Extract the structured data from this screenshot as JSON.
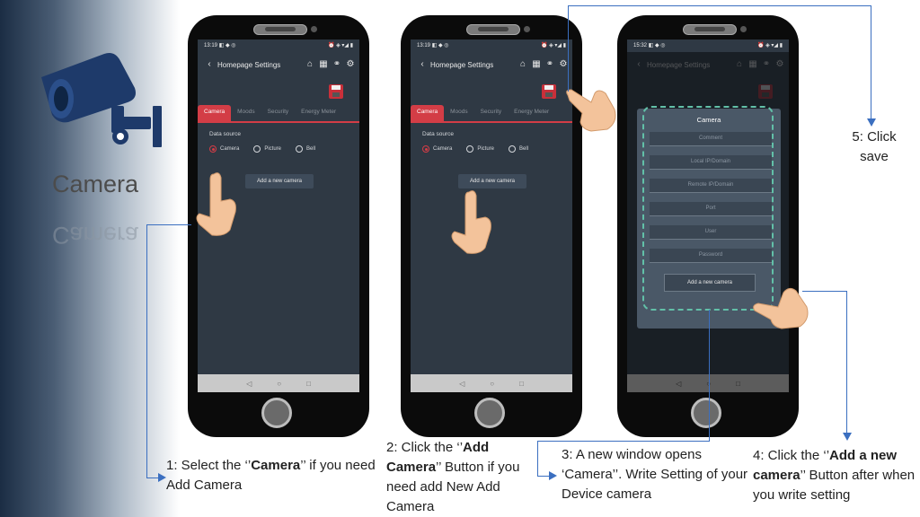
{
  "left_panel": {
    "title": "Camera"
  },
  "phones": [
    {
      "status_time": "13:19",
      "status_icons": "◧ ◆ ◎",
      "status_right": "⏰ ◈ ▾◢ ▮",
      "nav_title": "Homepage Settings",
      "tabs": [
        "Camera",
        "Moods",
        "Security",
        "Energy Meter"
      ],
      "data_source_label": "Data source",
      "radios": [
        "Camera",
        "Picture",
        "Bell"
      ],
      "add_button": "Add a new camera"
    },
    {
      "status_time": "13:19",
      "status_icons": "◧ ◆ ◎",
      "status_right": "⏰ ◈ ▾◢ ▮",
      "nav_title": "Homepage Settings",
      "tabs": [
        "Camera",
        "Moods",
        "Security",
        "Energy Meter"
      ],
      "data_source_label": "Data source",
      "radios": [
        "Camera",
        "Picture",
        "Bell"
      ],
      "add_button": "Add a new camera"
    },
    {
      "status_time": "15:32",
      "status_icons": "◧ ◆ ◎",
      "status_right": "⏰ ◈ ▾◢ ▮",
      "nav_title": "Homepage Settings",
      "dialog_title": "Camera",
      "fields": [
        "Comment",
        "Local IP/Domain",
        "Remote IP/Domain",
        "Port",
        "User",
        "Password"
      ],
      "dialog_button": "Add a new camera"
    }
  ],
  "captions": {
    "step1": {
      "pre": "1: Select the ‘’",
      "bold": "Camera",
      "post": "’’ if you need Add Camera"
    },
    "step2": {
      "pre": "2: Click the ‘’",
      "bold": "Add Camera",
      "post": "’’ Button if you need add New Add Camera"
    },
    "step3": {
      "text": "3: A new window opens ‘Camera’’. Write Setting of your Device camera"
    },
    "step4": {
      "pre": "4: Click the ‘’",
      "bold": "Add a new camera",
      "post": "’’ Button after when you write setting"
    },
    "step5": {
      "text": "5: Click save"
    }
  },
  "colors": {
    "accent_red": "#d33d46",
    "app_bg": "#2f3944",
    "callout_line": "#3b6fc0",
    "dialog_dash": "#62c0a8"
  },
  "icons": [
    "cctv-camera-icon",
    "back-chevron-icon",
    "home-icon",
    "grid-icon",
    "link-icon",
    "gear-icon",
    "save-floppy-icon",
    "pointing-hand-icon"
  ]
}
